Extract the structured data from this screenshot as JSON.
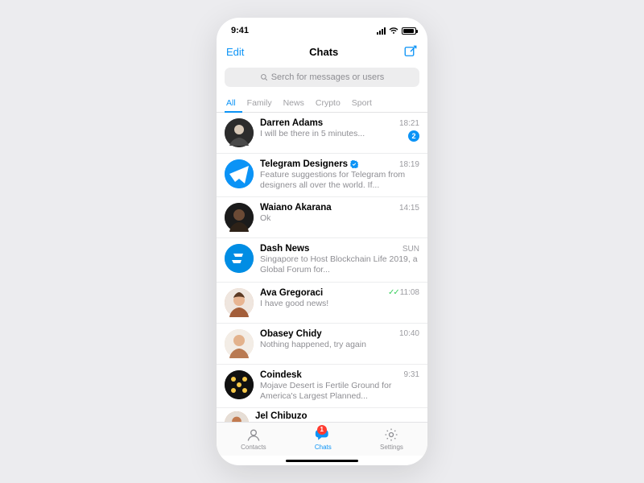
{
  "status": {
    "time": "9:41"
  },
  "header": {
    "edit": "Edit",
    "title": "Chats"
  },
  "search": {
    "placeholder": "Serch for messages or users"
  },
  "tabs": [
    "All",
    "Family",
    "News",
    "Crypto",
    "Sport"
  ],
  "chats": [
    {
      "name": "Darren Adams",
      "preview": "I will be there in 5 minutes...",
      "time": "18:21",
      "unread": "2",
      "verified": false,
      "read": false
    },
    {
      "name": "Telegram Designers",
      "preview": "Feature suggestions for Telegram from designers all over the world. If...",
      "time": "18:19",
      "unread": null,
      "verified": true,
      "read": false
    },
    {
      "name": "Waiano Akarana",
      "preview": "Ok",
      "time": "14:15",
      "unread": null,
      "verified": false,
      "read": false
    },
    {
      "name": "Dash News",
      "preview": "Singapore to Host Blockchain Life 2019, a Global Forum for...",
      "time": "SUN",
      "unread": null,
      "verified": false,
      "read": false
    },
    {
      "name": "Ava Gregoraci",
      "preview": "I have good news!",
      "time": "11:08",
      "unread": null,
      "verified": false,
      "read": true
    },
    {
      "name": "Obasey Chidy",
      "preview": "Nothing happened, try again",
      "time": "10:40",
      "unread": null,
      "verified": false,
      "read": false
    },
    {
      "name": "Coindesk",
      "preview": "Mojave Desert is Fertile Ground for America's Largest Planned...",
      "time": "9:31",
      "unread": null,
      "verified": false,
      "read": false
    },
    {
      "name": "Jel Chibuzo",
      "preview": "",
      "time": "",
      "unread": null,
      "verified": false,
      "read": false
    }
  ],
  "tabbar": {
    "contacts": "Contacts",
    "chats": "Chats",
    "settings": "Settings",
    "badge": "1"
  }
}
